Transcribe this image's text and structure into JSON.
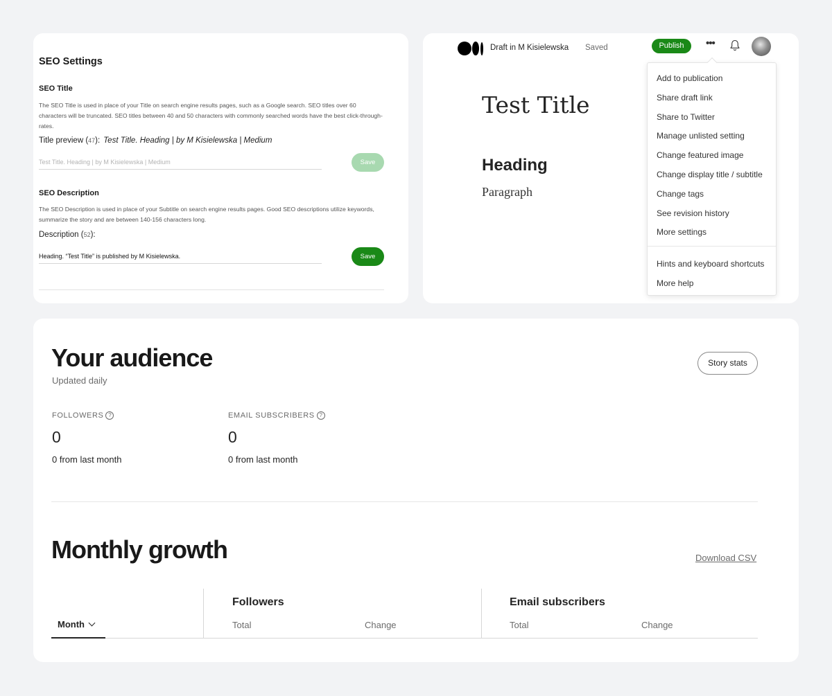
{
  "seo": {
    "heading": "SEO Settings",
    "title_section": {
      "label": "SEO Title",
      "description": "The SEO Title is used in place of your Title on search engine results pages, such as a Google search. SEO titles over 60 characters will be truncated. SEO titles between 40 and 50 characters with commonly searched words have the best click-through-rates.",
      "preview_label": "Title preview (",
      "preview_count": "47",
      "preview_suffix": "):",
      "preview_text": "Test Title. Heading | by M Kisielewska | Medium",
      "input_placeholder": "Test Title. Heading | by M Kisielewska | Medium",
      "save_label": "Save"
    },
    "description_section": {
      "label": "SEO Description",
      "description": "The SEO Description is used in place of your Subtitle on search engine results pages. Good SEO descriptions utilize keywords, summarize the story and are between 140-156 characters long.",
      "count_label": "Description (",
      "count": "52",
      "count_suffix": "):",
      "input_value": "Heading. “Test Title” is published by M Kisielewska.",
      "save_label": "Save"
    }
  },
  "editor": {
    "draft_label": "Draft in M Kisielewska",
    "status": "Saved",
    "publish_label": "Publish",
    "more_icon": "•••",
    "story": {
      "title": "Test Title",
      "heading": "Heading",
      "paragraph": "Paragraph"
    },
    "menu": {
      "items": [
        "Add to publication",
        "Share draft link",
        "Share to Twitter",
        "Manage unlisted setting",
        "Change featured image",
        "Change display title / subtitle",
        "Change tags",
        "See revision history",
        "More settings"
      ],
      "secondary_items": [
        "Hints and keyboard shortcuts",
        "More help"
      ]
    }
  },
  "audience": {
    "title": "Your audience",
    "subtitle": "Updated daily",
    "story_stats_label": "Story stats",
    "stats": [
      {
        "label": "FOLLOWERS",
        "value": "0",
        "change": "0  from last month"
      },
      {
        "label": "EMAIL SUBSCRIBERS",
        "value": "0",
        "change": "0  from last month"
      }
    ],
    "help_icon": "?"
  },
  "growth": {
    "title": "Monthly growth",
    "download_label": "Download CSV",
    "month_label": "Month",
    "columns": [
      {
        "heading": "Followers",
        "sub": [
          "Total",
          "Change"
        ]
      },
      {
        "heading": "Email subscribers",
        "sub": [
          "Total",
          "Change"
        ]
      }
    ]
  },
  "colors": {
    "accent_green": "#1a8917",
    "disabled_green": "#a8d9b0",
    "text": "#242424",
    "muted": "#6b6b6b",
    "background": "#f2f3f5"
  }
}
